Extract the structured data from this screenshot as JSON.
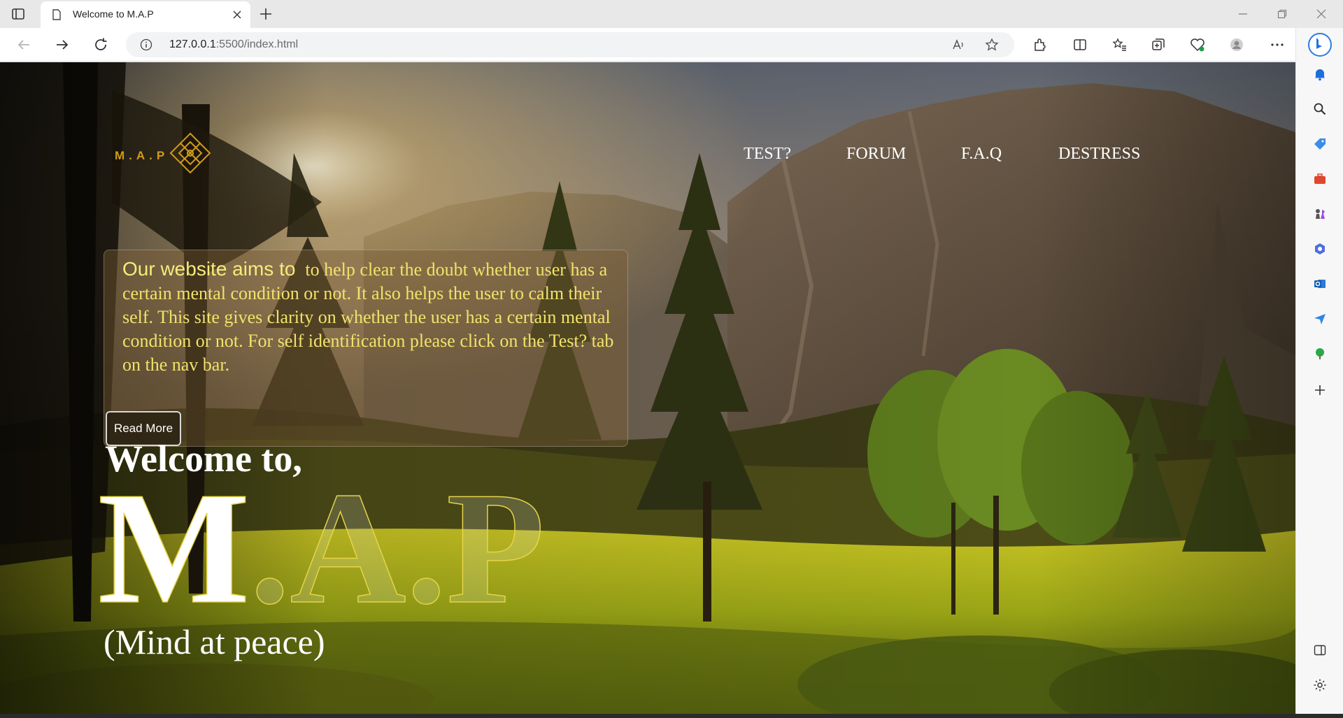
{
  "browser": {
    "tab_title": "Welcome to M.A.P",
    "url_host": "127.0.0.1",
    "url_rest": ":5500/index.html"
  },
  "site": {
    "logo_text": "M.A.P",
    "nav": [
      "TEST?",
      "FORUM",
      "F.A.Q",
      "DESTRESS"
    ],
    "aim": {
      "lead": "Our website aims to",
      "body": "to help clear the doubt whether user has a certain mental condition or not. It also helps the user to calm their self. This site gives clarity on whether the user has a certain mental condition or not. For self identification please click on the Test? tab on the nav bar.",
      "button": "Read More"
    },
    "welcome": "Welcome to,",
    "big_title": "M.A.P",
    "subtitle": "(Mind at peace)"
  },
  "colors": {
    "logo_gold": "#d39a1a",
    "aim_text": "#f1e36a",
    "title_outline": "#e6d44a"
  }
}
